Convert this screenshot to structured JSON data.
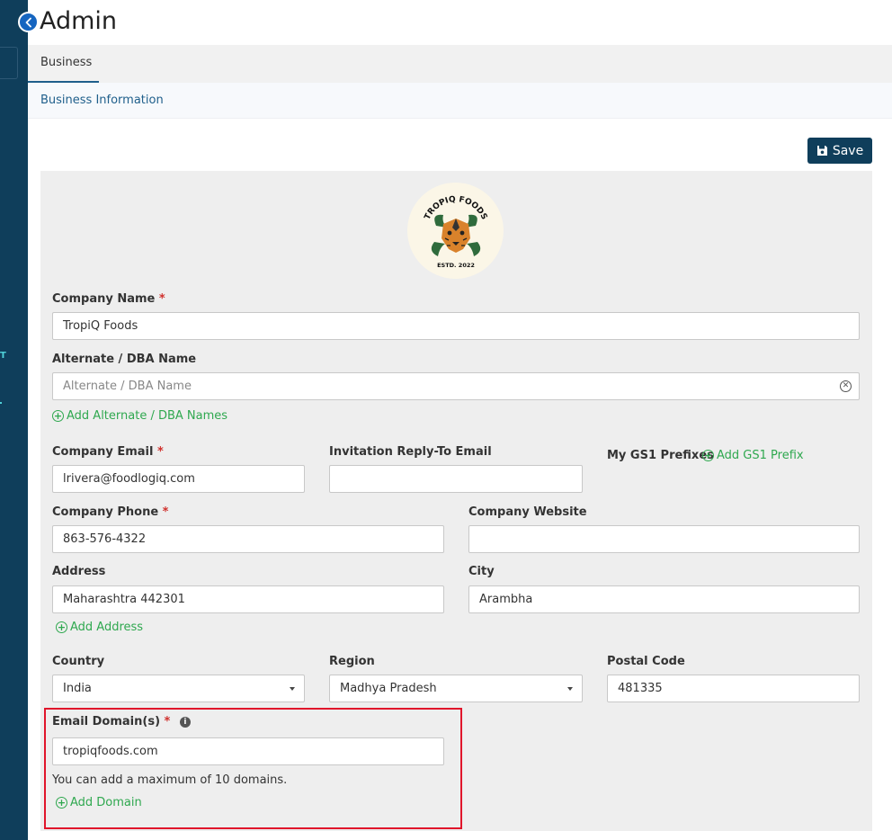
{
  "header": {
    "title": "Admin"
  },
  "tabs": [
    {
      "label": "Business"
    }
  ],
  "subnav": [
    {
      "label": "Business Information"
    }
  ],
  "toolbar": {
    "save_label": "Save"
  },
  "logo": {
    "name": "TROPIQ FOODS",
    "est": "ESTD. 2022",
    "colors": {
      "bg": "#fbf6e7",
      "tiger": "#d9822b",
      "leaves": "#2f6b3c"
    }
  },
  "form": {
    "company_name": {
      "label": "Company Name",
      "required": "*",
      "value": "TropiQ Foods"
    },
    "alt_name": {
      "label": "Alternate / DBA Name",
      "placeholder": "Alternate / DBA Name",
      "add_label": "Add Alternate / DBA Names"
    },
    "company_email": {
      "label": "Company Email",
      "required": "*",
      "value": "lrivera@foodlogiq.com"
    },
    "invitation_email": {
      "label": "Invitation Reply-To Email",
      "value": ""
    },
    "gs1": {
      "label": "My GS1 Prefixes",
      "add_label": "Add GS1 Prefix"
    },
    "company_phone": {
      "label": "Company Phone",
      "required": "*",
      "value": "863-576-4322"
    },
    "company_website": {
      "label": "Company Website",
      "value": ""
    },
    "address": {
      "label": "Address",
      "value": "Maharashtra 442301",
      "add_label": "Add Address"
    },
    "city": {
      "label": "City",
      "value": "Arambha"
    },
    "country": {
      "label": "Country",
      "value": "India"
    },
    "region": {
      "label": "Region",
      "value": "Madhya Pradesh"
    },
    "postal_code": {
      "label": "Postal Code",
      "value": "481335"
    },
    "email_domains": {
      "label": "Email Domain(s)",
      "required": "*",
      "value": "tropiqfoods.com",
      "hint": "You can add a maximum of 10 domains.",
      "add_label": "Add Domain"
    }
  },
  "colors": {
    "sidebar": "#0f3e5b",
    "accent_green": "#2fa84f",
    "highlight": "#e0152b",
    "link_blue": "#1f5f8b"
  }
}
